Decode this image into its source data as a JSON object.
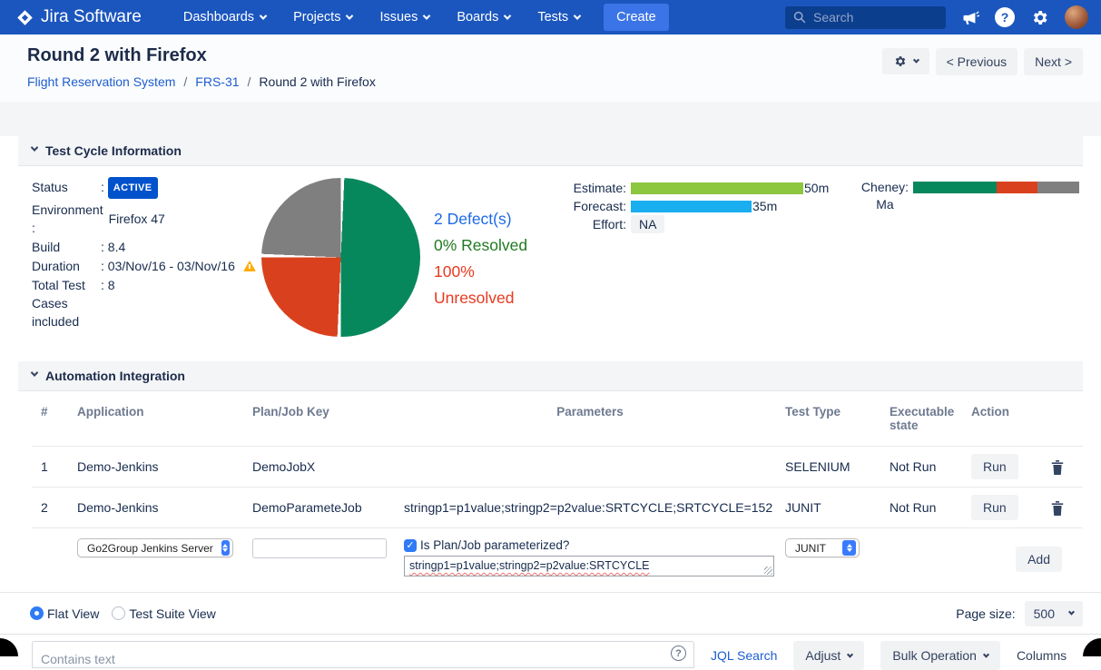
{
  "colors": {
    "navbar": "#1B56BE",
    "link": "#1D5DD0",
    "badge": "#0052CC"
  },
  "navbar": {
    "logo": "Jira Software",
    "menus": [
      "Dashboards",
      "Projects",
      "Issues",
      "Boards",
      "Tests"
    ],
    "create_label": "Create",
    "search_placeholder": "Search"
  },
  "header": {
    "title": "Round 2 with Firefox",
    "breadcrumb": [
      "Flight Reservation System",
      "FRS-31",
      "Round 2 with Firefox"
    ],
    "separator": "/",
    "prev_label": "< Previous",
    "next_label": "Next >"
  },
  "cycle_info": {
    "section_title": "Test Cycle Information",
    "colon": ":",
    "status_label": "Status",
    "status_value": "ACTIVE",
    "environment_label": "Environment\n:",
    "environment_value": "Firefox 47",
    "build_label": "Build",
    "build_value": "8.4",
    "duration_label": "Duration",
    "duration_value": "03/Nov/16 - 03/Nov/16",
    "total_label": "Total Test Cases included",
    "total_value": "8",
    "defects_count": "2 Defect(s)",
    "resolved_text": "0% Resolved",
    "unresolved_text": "100% Unresolved",
    "estimate_label": "Estimate:",
    "estimate_value": "50m",
    "forecast_label": "Forecast:",
    "forecast_value": "35m",
    "effort_label": "Effort:",
    "effort_value": "NA",
    "tester_label": "Cheney: Ma"
  },
  "chart_data": [
    {
      "type": "pie",
      "title": "Test cycle execution status donut",
      "segments": [
        {
          "label": "green",
          "pct": 50,
          "color": "#07885C"
        },
        {
          "label": "red",
          "pct": 25,
          "color": "#D9411E"
        },
        {
          "label": "gray",
          "pct": 25,
          "color": "#7F7F7F"
        }
      ],
      "annotations": [
        "2 Defect(s)",
        "0% Resolved",
        "100% Unresolved"
      ]
    },
    {
      "type": "bar",
      "categories": [
        "Estimate",
        "Forecast"
      ],
      "values": [
        50,
        35
      ],
      "unit": "minutes",
      "max": 50,
      "colors": [
        "#8DC63F",
        "#19AEEF"
      ],
      "value_labels": [
        "50m",
        "35m"
      ]
    },
    {
      "type": "bar",
      "title": "Cheney: Ma",
      "stacked": true,
      "segments": [
        {
          "label": "green",
          "pct": 50,
          "color": "#07885C"
        },
        {
          "label": "red",
          "pct": 25,
          "color": "#D9411E"
        },
        {
          "label": "gray",
          "pct": 25,
          "color": "#7F7F7F"
        }
      ]
    }
  ],
  "automation": {
    "section_title": "Automation Integration",
    "columns": [
      "#",
      "Application",
      "Plan/Job Key",
      "Parameters",
      "Test Type",
      "Executable state",
      "Action"
    ],
    "rows": [
      {
        "num": "1",
        "application": "Demo-Jenkins",
        "plan_job_key": "DemoJobX",
        "parameters": "",
        "test_type": "SELENIUM",
        "executable_state": "Not Run",
        "run_label": "Run"
      },
      {
        "num": "2",
        "application": "Demo-Jenkins",
        "plan_job_key": "DemoParameteJob",
        "parameters": "stringp1=p1value;stringp2=p2value:SRTCYCLE;SRTCYCLE=152",
        "test_type": "JUNIT",
        "executable_state": "Not Run",
        "run_label": "Run"
      }
    ],
    "add_form": {
      "server_select": "Go2Group Jenkins Server",
      "plan_job_input": "",
      "parameterized_label": "Is Plan/Job parameterized?",
      "checkbox_checked": "✓",
      "parameters_value": "stringp1=p1value;stringp2=p2value:SRTCYCLE",
      "test_type_select": "JUNIT",
      "add_label": "Add"
    }
  },
  "footer": {
    "flat_view": "Flat View",
    "test_suite_view": "Test Suite View",
    "page_size_label": "Page size:",
    "page_size_value": "500",
    "contains_placeholder": "Contains text",
    "help_glyph": "?",
    "jql_search": "JQL Search",
    "adjust": "Adjust",
    "bulk_operation": "Bulk Operation",
    "columns_label": "Columns"
  }
}
